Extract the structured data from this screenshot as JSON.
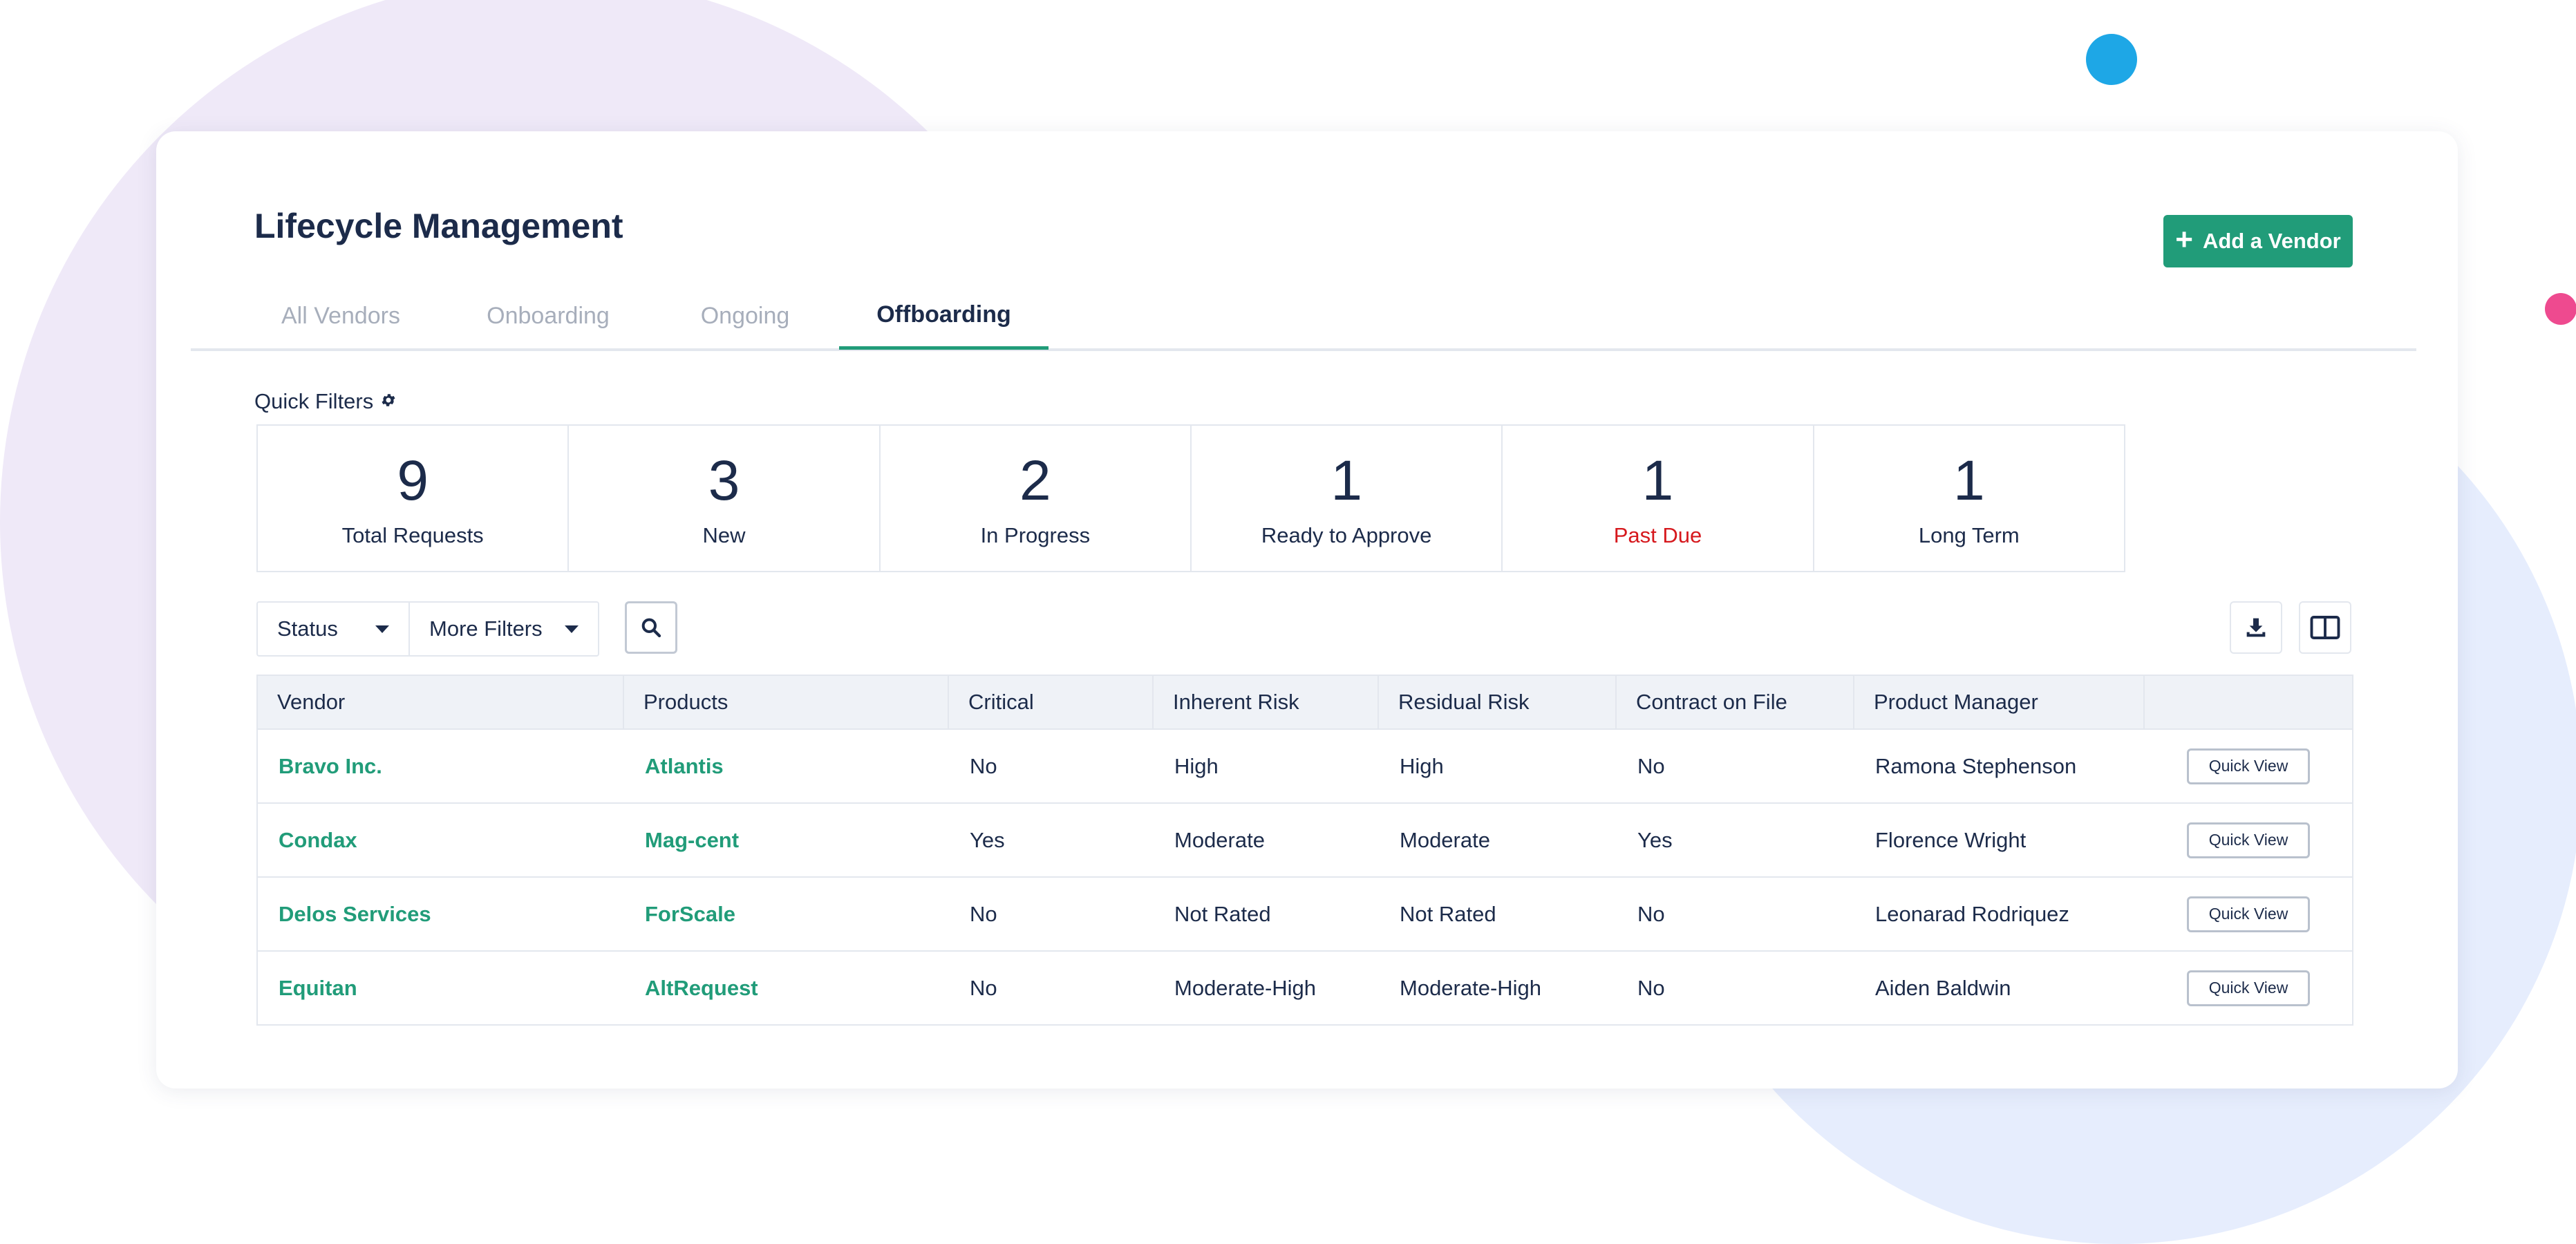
{
  "page": {
    "title": "Lifecycle Management",
    "add_button_label": "Add a Vendor"
  },
  "tabs": [
    {
      "label": "All Vendors",
      "active": false
    },
    {
      "label": "Onboarding",
      "active": false
    },
    {
      "label": "Ongoing",
      "active": false
    },
    {
      "label": "Offboarding",
      "active": true
    }
  ],
  "quick_filters": {
    "label": "Quick Filters",
    "stats": [
      {
        "value": "9",
        "label": "Total Requests"
      },
      {
        "value": "3",
        "label": "New"
      },
      {
        "value": "2",
        "label": "In Progress"
      },
      {
        "value": "1",
        "label": "Ready to Approve"
      },
      {
        "value": "1",
        "label": "Past Due"
      },
      {
        "value": "1",
        "label": "Long Term"
      }
    ]
  },
  "filters": {
    "status_label": "Status",
    "more_filters_label": "More Filters"
  },
  "table": {
    "columns": [
      "Vendor",
      "Products",
      "Critical",
      "Inherent Risk",
      "Residual Risk",
      "Contract on File",
      "Product Manager",
      ""
    ],
    "rows": [
      {
        "vendor": "Bravo Inc.",
        "product": "Atlantis",
        "critical": "No",
        "inherent_risk": "High",
        "residual_risk": "High",
        "contract": "No",
        "manager": "Ramona Stephenson",
        "action": "Quick View"
      },
      {
        "vendor": "Condax",
        "product": "Mag-cent",
        "critical": "Yes",
        "inherent_risk": "Moderate",
        "residual_risk": "Moderate",
        "contract": "Yes",
        "manager": "Florence Wright",
        "action": "Quick View"
      },
      {
        "vendor": "Delos Services",
        "product": "ForScale",
        "critical": "No",
        "inherent_risk": "Not Rated",
        "residual_risk": "Not Rated",
        "contract": "No",
        "manager": "Leonarad Rodriquez",
        "action": "Quick View"
      },
      {
        "vendor": "Equitan",
        "product": "AltRequest",
        "critical": "No",
        "inherent_risk": "Moderate-High",
        "residual_risk": "Moderate-High",
        "contract": "No",
        "manager": "Aiden Baldwin",
        "action": "Quick View"
      }
    ]
  },
  "colors": {
    "accent": "#219c79",
    "text": "#1c2b4a",
    "muted": "#a7aebb",
    "danger": "#d6181d",
    "border": "#e3e7ee",
    "header_bg": "#eff2f7"
  },
  "icons": [
    "plus-icon",
    "gear-icon",
    "caret-down-icon",
    "search-icon",
    "download-icon",
    "columns-icon"
  ]
}
